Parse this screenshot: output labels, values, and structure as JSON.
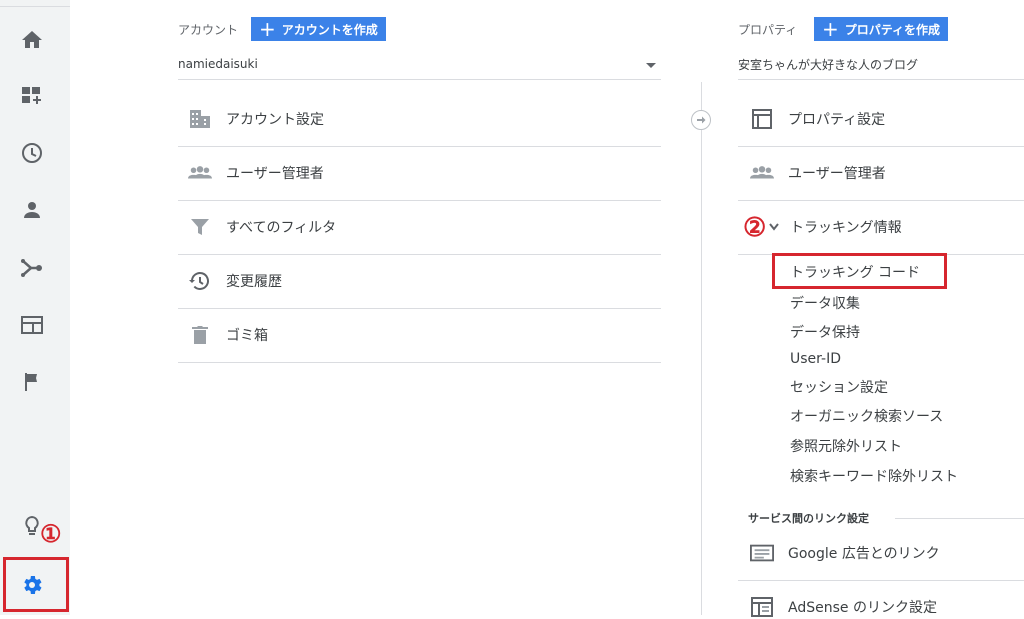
{
  "sidebar": {
    "icons": [
      "home-icon",
      "dashboard-icon",
      "clock-icon",
      "person-icon",
      "acquisition-icon",
      "behavior-icon",
      "flag-icon",
      "lightbulb-icon",
      "gear-icon"
    ],
    "annotation_1": "①"
  },
  "account": {
    "label": "アカウント",
    "create_button": "アカウントを作成",
    "selected": "namiedaisuki",
    "items": [
      "アカウント設定",
      "ユーザー管理者",
      "すべてのフィルタ",
      "変更履歴",
      "ゴミ箱"
    ]
  },
  "property": {
    "label": "プロパティ",
    "create_button": "プロパティを作成",
    "selected": "安室ちゃんが大好きな人のブログ",
    "items": [
      "プロパティ設定",
      "ユーザー管理者",
      "トラッキング情報"
    ],
    "annotation_2": "②",
    "tracking_sub": [
      "トラッキング コード",
      "データ収集",
      "データ保持",
      "User-ID",
      "セッション設定",
      "オーガニック検索ソース",
      "参照元除外リスト",
      "検索キーワード除外リスト"
    ],
    "link_section_title": "サービス間のリンク設定",
    "link_items": [
      "Google 広告とのリンク",
      "AdSense のリンク設定"
    ]
  },
  "colors": {
    "accent": "#3b82e8",
    "annotation": "#d6262e",
    "sidebar_bg": "#f1f3f4",
    "icon": "#5f6368"
  }
}
